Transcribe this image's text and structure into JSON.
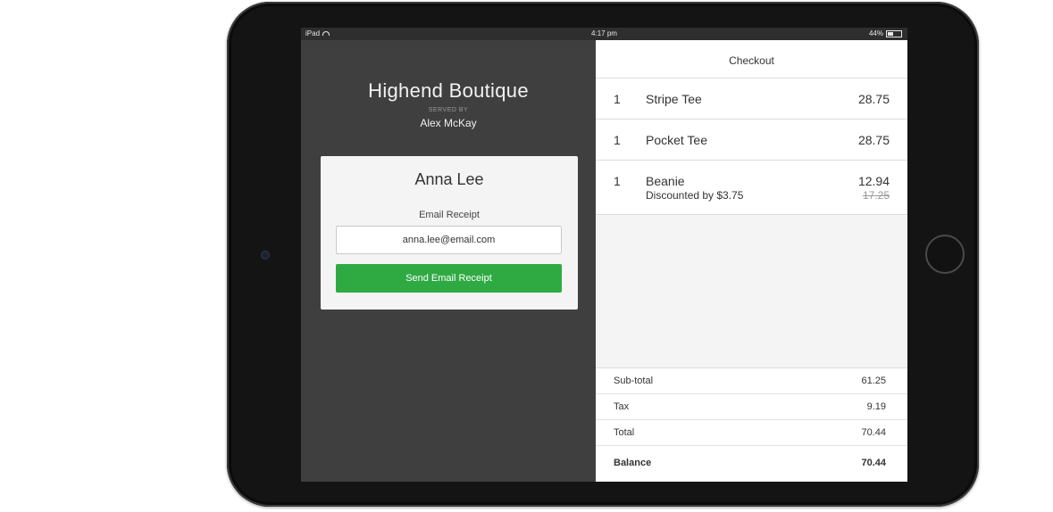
{
  "status_bar": {
    "device": "iPad",
    "time": "4:17 pm",
    "battery": "44%",
    "battery_level": 0.44
  },
  "store": {
    "name": "Highend Boutique",
    "served_by_label": "SERVED BY",
    "server_name": "Alex McKay"
  },
  "receipt_card": {
    "customer_name": "Anna Lee",
    "email_label": "Email Receipt",
    "email_value": "anna.lee@email.com",
    "send_button_label": "Send Email Receipt",
    "button_color": "#2faa43"
  },
  "checkout": {
    "title": "Checkout",
    "items": [
      {
        "qty": "1",
        "name": "Stripe Tee",
        "price": "28.75"
      },
      {
        "qty": "1",
        "name": "Pocket Tee",
        "price": "28.75"
      },
      {
        "qty": "1",
        "name": "Beanie",
        "price": "12.94",
        "note": "Discounted by $3.75",
        "original_price": "17.25"
      }
    ],
    "totals": {
      "subtotal_label": "Sub-total",
      "subtotal": "61.25",
      "tax_label": "Tax",
      "tax": "9.19",
      "total_label": "Total",
      "total": "70.44",
      "balance_label": "Balance",
      "balance": "70.44"
    }
  }
}
